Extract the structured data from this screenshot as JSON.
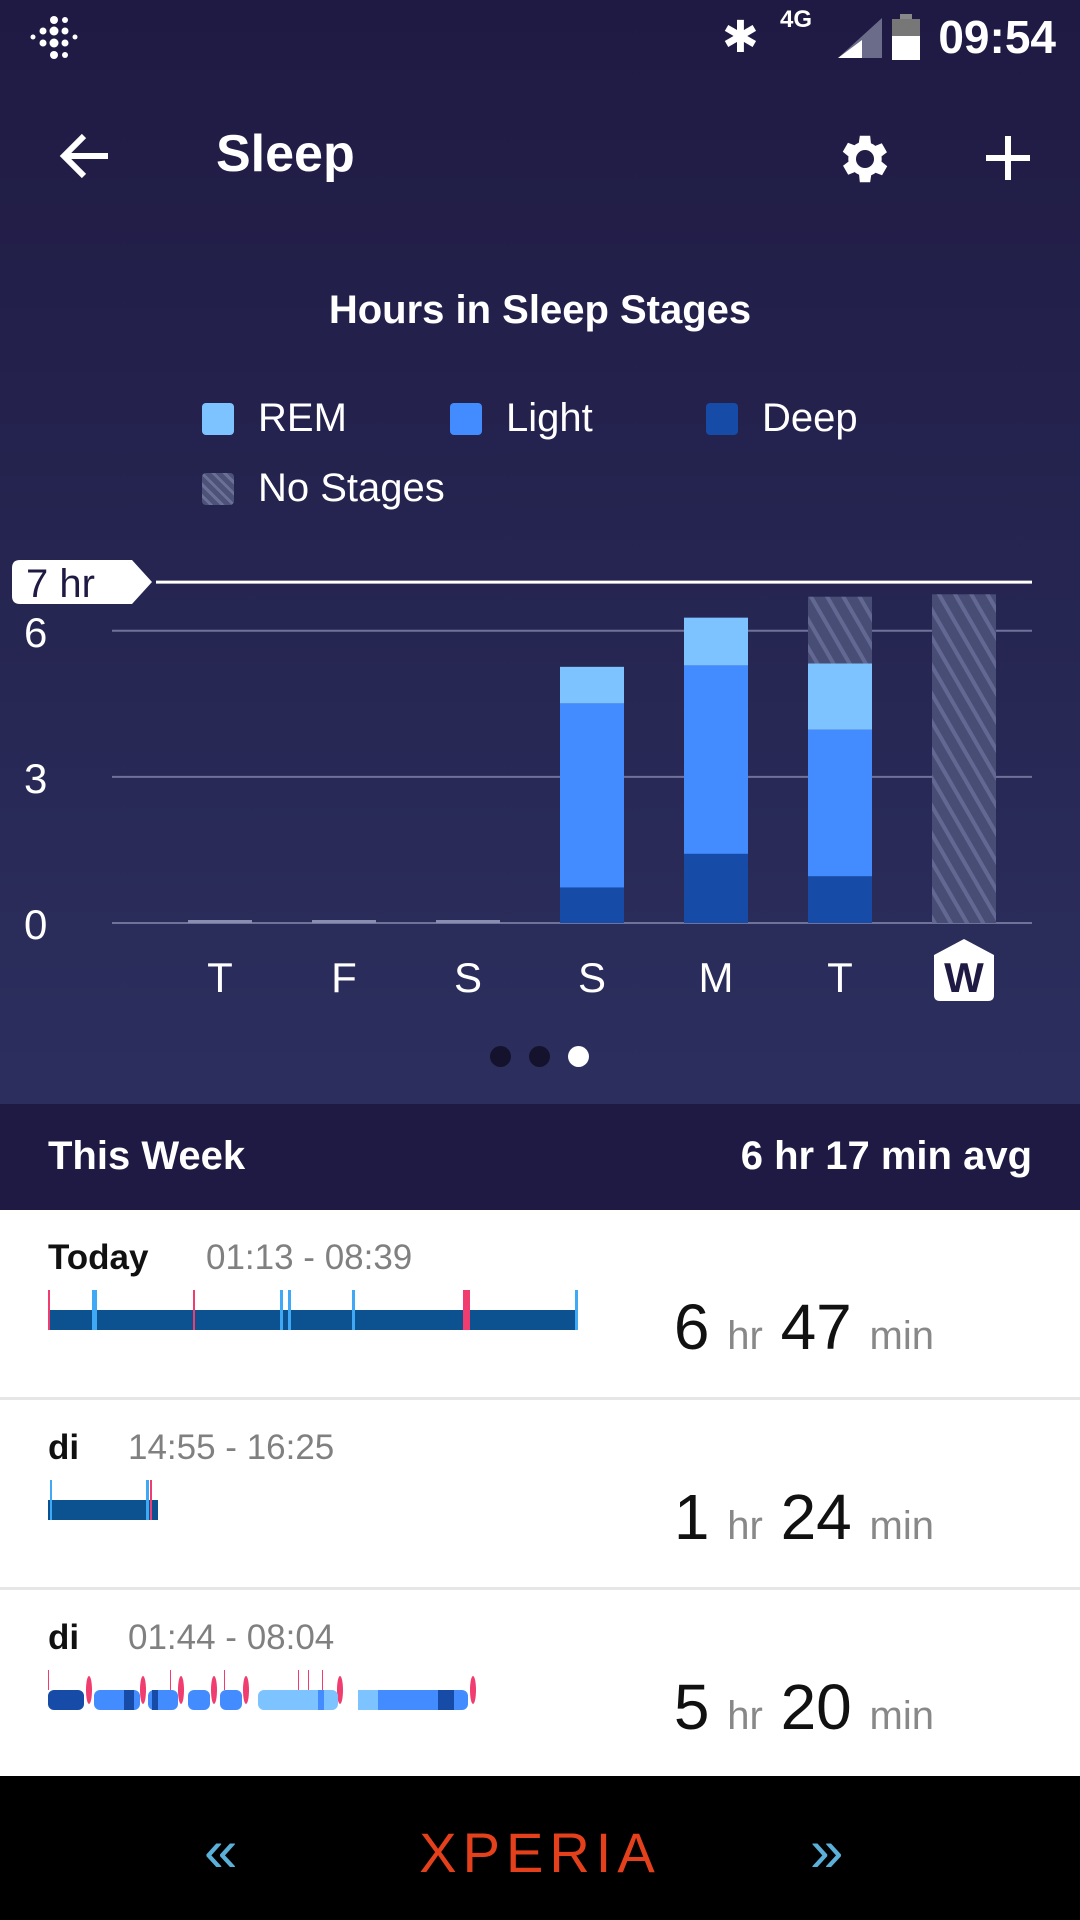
{
  "status_bar": {
    "network": "4G",
    "time": "09:54"
  },
  "header": {
    "title": "Sleep"
  },
  "chart_data": {
    "type": "bar",
    "stacked": true,
    "title": "Hours in Sleep Stages",
    "categories": [
      "T",
      "F",
      "S",
      "S",
      "M",
      "T",
      "W"
    ],
    "series": [
      {
        "name": "Deep",
        "color": "#164ba8",
        "values": [
          0,
          0,
          0,
          0.73,
          1.42,
          0.96,
          0
        ]
      },
      {
        "name": "Light",
        "color": "#428cff",
        "values": [
          0,
          0,
          0,
          3.78,
          3.87,
          3.01,
          0
        ]
      },
      {
        "name": "REM",
        "color": "#7dc3ff",
        "values": [
          0,
          0,
          0,
          0.75,
          0.98,
          1.36,
          0
        ]
      },
      {
        "name": "No Stages",
        "color": "#4d5378",
        "values": [
          0,
          0,
          0,
          0,
          0,
          1.37,
          6.75
        ]
      }
    ],
    "legend": [
      "REM",
      "Light",
      "Deep",
      "No Stages"
    ],
    "yticks": [
      "0",
      "3",
      "6"
    ],
    "ylim": [
      0,
      7.3
    ],
    "goal": {
      "value": 7,
      "label": "7 hr"
    },
    "selected": "W",
    "grid": true
  },
  "pager": {
    "pages": 3,
    "current": 3
  },
  "summary": {
    "label": "This Week",
    "avg": "6 hr 17 min avg"
  },
  "entries": [
    {
      "day": "Today",
      "time": "01:13 - 08:39",
      "h": "6",
      "hu": "hr",
      "m": "47",
      "mu": "min"
    },
    {
      "day": "di",
      "time": "14:55 - 16:25",
      "h": "1",
      "hu": "hr",
      "m": "24",
      "mu": "min"
    },
    {
      "day": "di",
      "time": "01:44 - 08:04",
      "h": "5",
      "hu": "hr",
      "m": "20",
      "mu": "min"
    }
  ],
  "nav": {
    "brand": "XPERIA"
  }
}
